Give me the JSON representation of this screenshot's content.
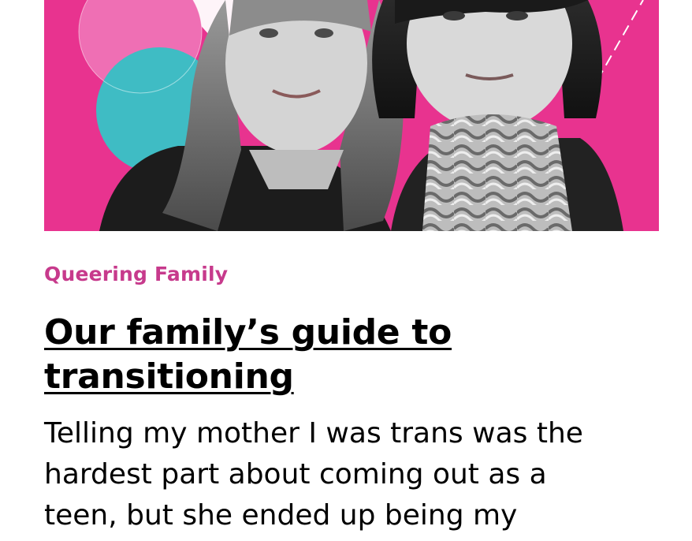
{
  "article": {
    "category": "Queering Family",
    "headline": "Our family’s guide to transitioning",
    "dek_lines": [
      "Telling my mother I was trans was the",
      "hardest part about coming out as a",
      "teen, but she ended up being my"
    ]
  },
  "hero_image": {
    "background_color": "#e8338f",
    "accent_colors": [
      "#3fbcc4",
      "#ef6fb4"
    ],
    "subjects": [
      "woman-left",
      "person-right"
    ]
  },
  "colors": {
    "category_text": "#c73a8c",
    "headline_text": "#000000",
    "body_text": "#000000"
  }
}
